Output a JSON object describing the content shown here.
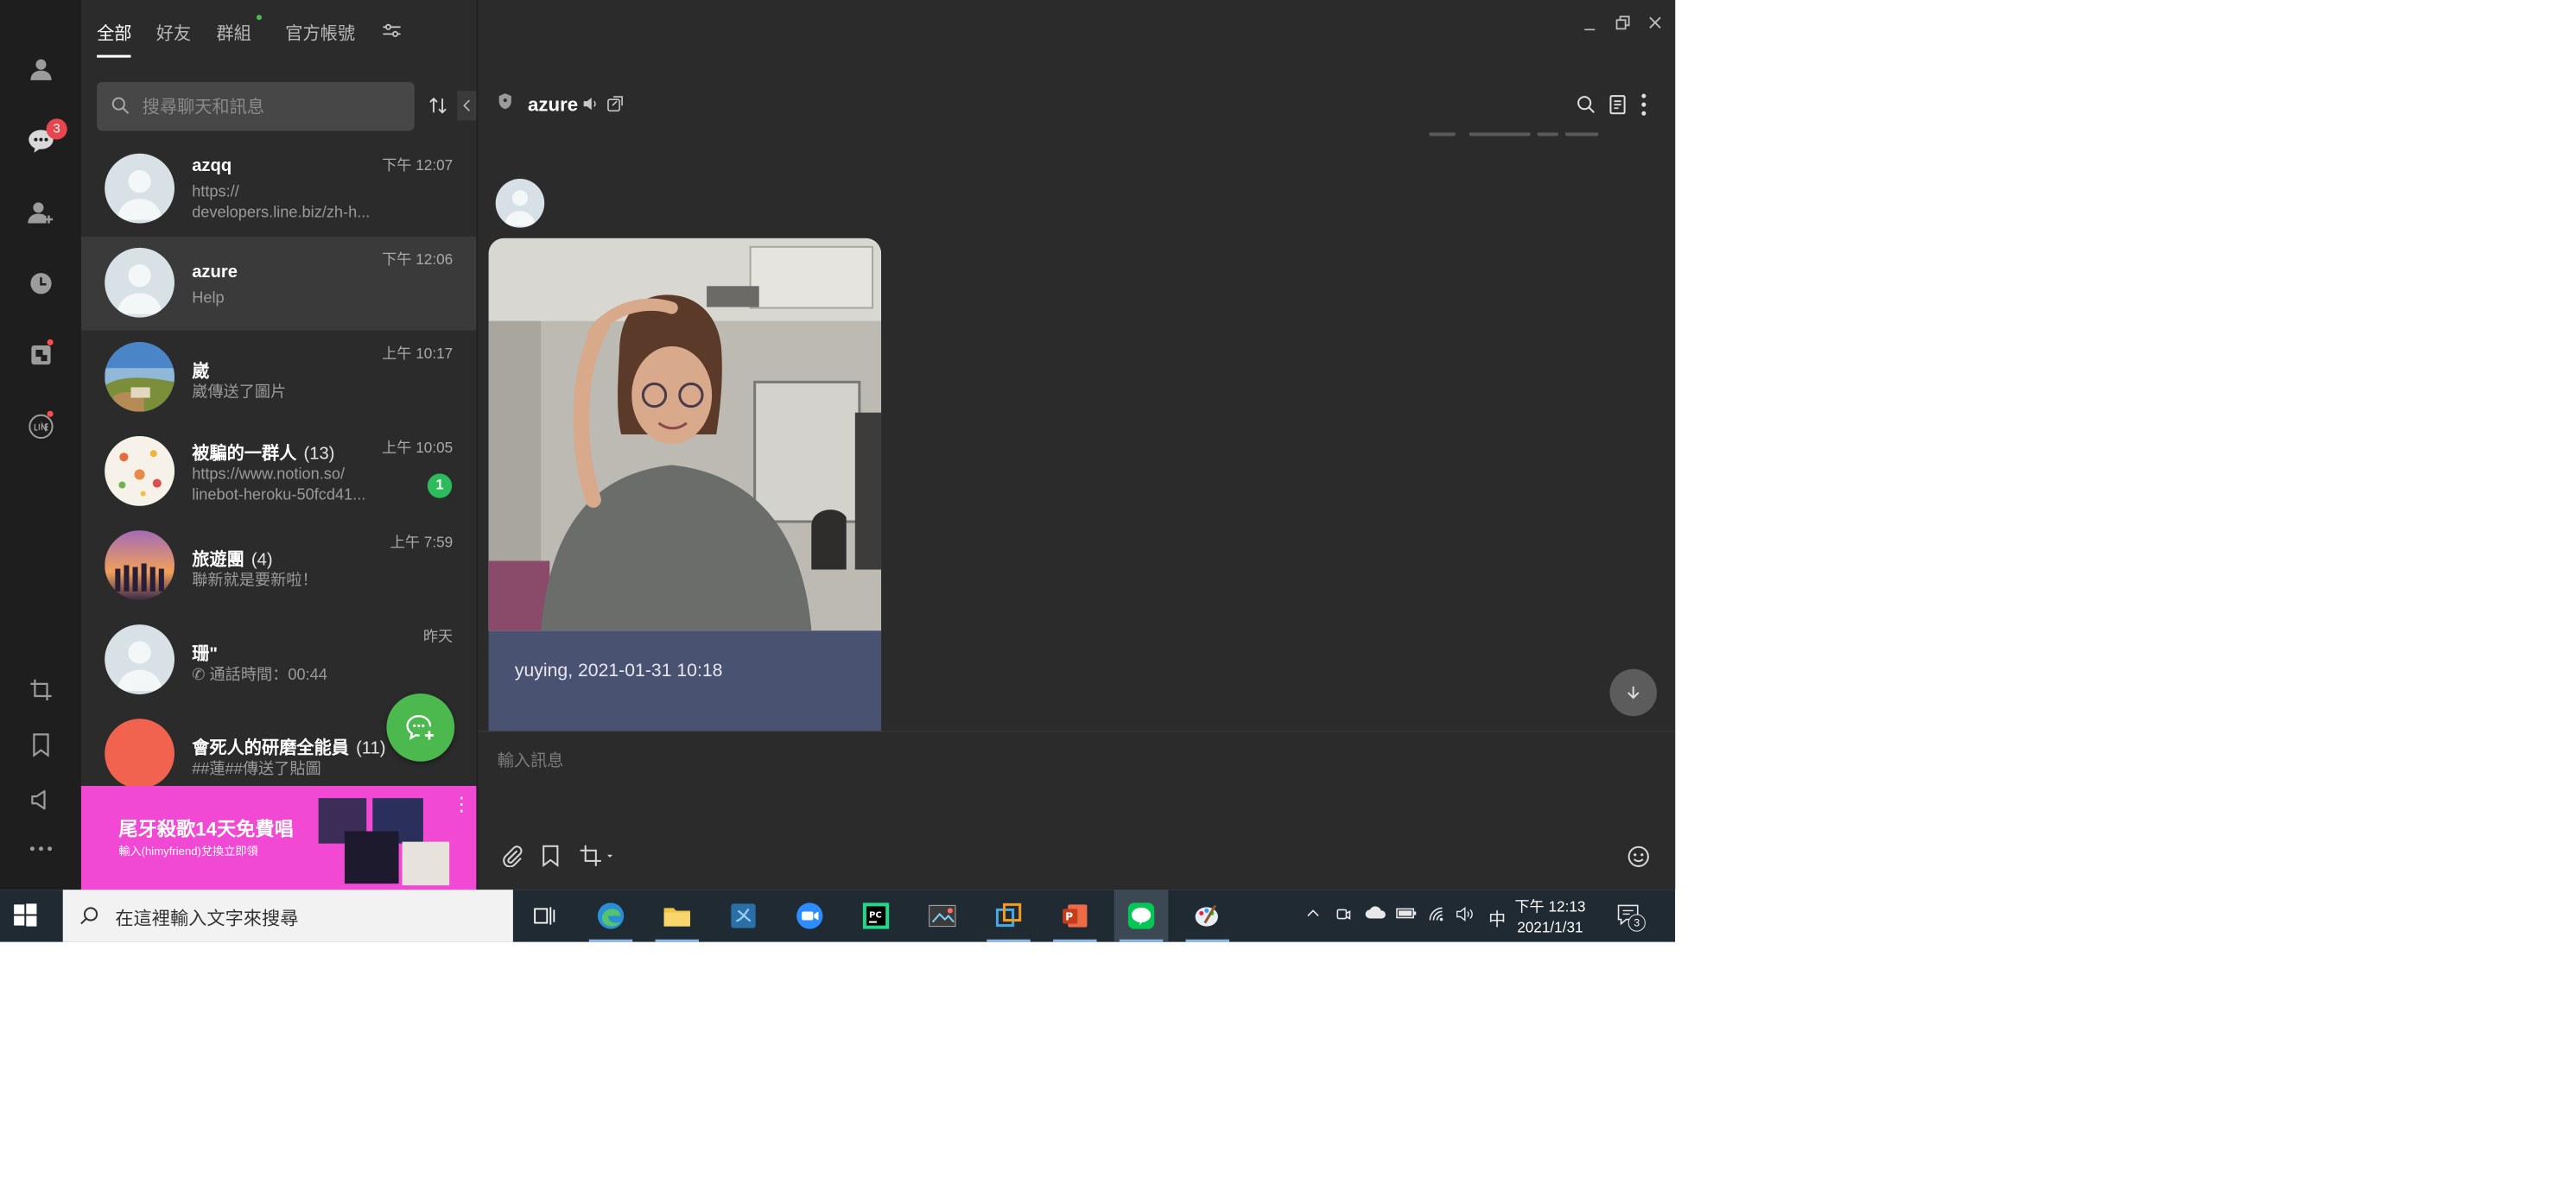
{
  "tabs": [
    "全部",
    "好友",
    "群組",
    "官方帳號"
  ],
  "rail": {
    "chat_badge": "3"
  },
  "search": {
    "placeholder": "搜尋聊天和訊息"
  },
  "chats": [
    {
      "name": "azqq",
      "count": "",
      "time": "下午 12:07",
      "preview": "https://\ndevelopers.line.biz/zh-h...",
      "unread": ""
    },
    {
      "name": "azure",
      "count": "",
      "time": "下午 12:06",
      "preview": "Help",
      "unread": ""
    },
    {
      "name": "崴",
      "count": "",
      "time": "上午 10:17",
      "preview": "崴傳送了圖片",
      "unread": ""
    },
    {
      "name": "被騙的一群人",
      "count": "(13)",
      "time": "上午 10:05",
      "preview": "https://www.notion.so/\nlinebot-heroku-50fcd41...",
      "unread": "1"
    },
    {
      "name": "旅遊團",
      "count": "(4)",
      "time": "上午 7:59",
      "preview": "聯新就是要新啦！",
      "unread": ""
    },
    {
      "name": "珊\"",
      "count": "",
      "time": "昨天",
      "preview": "通話時間：00:44",
      "unread": ""
    },
    {
      "name": "會死人的研磨全能員",
      "count": "(11)",
      "time": "",
      "preview": "##蓮##傳送了貼圖",
      "unread": ""
    }
  ],
  "ad": {
    "title": "尾牙殺歌14天免費唱",
    "subtitle": "輸入(himyfriend)兌換立即領"
  },
  "chat": {
    "title": "azure",
    "caption": "yuying, 2021-01-31 10:18",
    "composer_placeholder": "輸入訊息"
  },
  "taskbar": {
    "search_placeholder": "在這裡輸入文字來搜尋",
    "ime": "中",
    "time": "下午 12:13",
    "date": "2021/1/31",
    "notification_count": "3"
  },
  "colors": {
    "chat_bg": "#2b2b2b",
    "rail_bg": "#1e1e1e",
    "line_green": "#4cb94f",
    "ad_pink": "#f249d4",
    "badge_red": "#e8464e"
  }
}
